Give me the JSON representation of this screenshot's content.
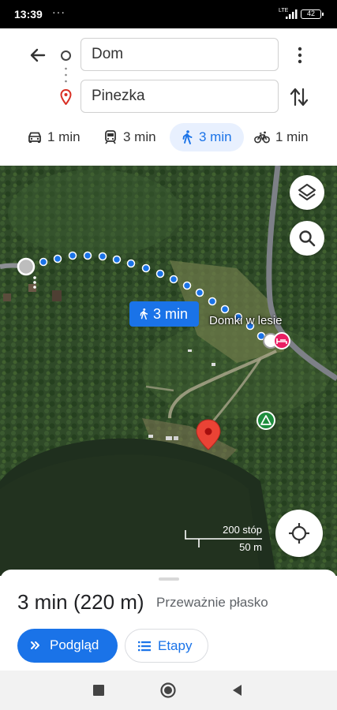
{
  "status_bar": {
    "time": "13:39",
    "notification_dots": "···",
    "network": "LTE",
    "battery": "42"
  },
  "directions": {
    "from": "Dom",
    "to": "Pinezka"
  },
  "modes": [
    {
      "name": "car",
      "label": "1 min",
      "icon": "car-icon"
    },
    {
      "name": "transit",
      "label": "3 min",
      "icon": "train-icon"
    },
    {
      "name": "walk",
      "label": "3 min",
      "icon": "walk-icon",
      "selected": true
    },
    {
      "name": "bike",
      "label": "1 min",
      "icon": "bike-icon"
    }
  ],
  "map": {
    "route_badge": "3 min",
    "place_label": "Domki w lesie",
    "scale_imperial": "200 stóp",
    "scale_metric": "50 m"
  },
  "summary": {
    "duration": "3 min",
    "distance": "(220 m)",
    "terrain": "Przeważnie płasko",
    "preview_button": "Podgląd",
    "steps_button": "Etapy"
  },
  "colors": {
    "accent": "#1a73e8",
    "pin": "#e53935",
    "campsite": "#1e8e3e"
  }
}
